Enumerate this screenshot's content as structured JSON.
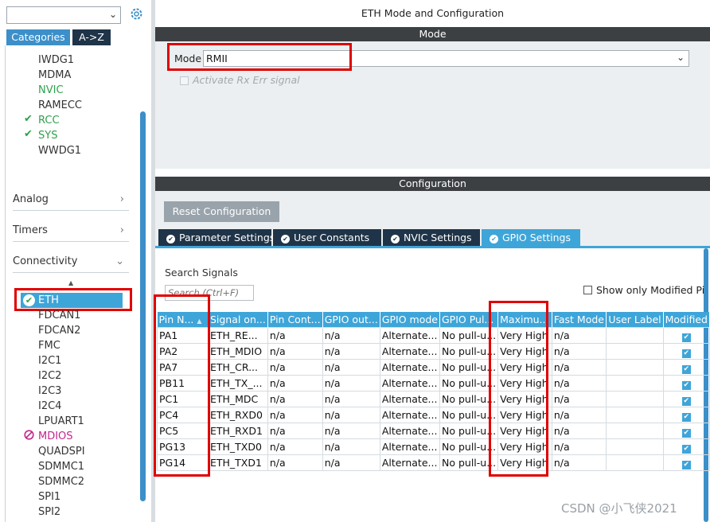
{
  "sidebar": {
    "tabs": [
      "Categories",
      "A->Z"
    ],
    "top_items": [
      {
        "label": "IWDG1",
        "state": "normal"
      },
      {
        "label": "MDMA",
        "state": "normal"
      },
      {
        "label": "NVIC",
        "state": "green"
      },
      {
        "label": "RAMECC",
        "state": "normal"
      },
      {
        "label": "RCC",
        "state": "checked"
      },
      {
        "label": "SYS",
        "state": "checked"
      },
      {
        "label": "WWDG1",
        "state": "normal"
      }
    ],
    "groups": [
      "Analog",
      "Timers",
      "Connectivity"
    ],
    "selected": "ETH",
    "connectivity_items": [
      {
        "label": "FDCAN1",
        "state": "normal"
      },
      {
        "label": "FDCAN2",
        "state": "normal"
      },
      {
        "label": "FMC",
        "state": "normal"
      },
      {
        "label": "I2C1",
        "state": "normal"
      },
      {
        "label": "I2C2",
        "state": "normal"
      },
      {
        "label": "I2C3",
        "state": "normal"
      },
      {
        "label": "I2C4",
        "state": "normal"
      },
      {
        "label": "LPUART1",
        "state": "normal"
      },
      {
        "label": "MDIOS",
        "state": "disabled"
      },
      {
        "label": "QUADSPI",
        "state": "normal"
      },
      {
        "label": "SDMMC1",
        "state": "normal"
      },
      {
        "label": "SDMMC2",
        "state": "normal"
      },
      {
        "label": "SPI1",
        "state": "normal"
      },
      {
        "label": "SPI2",
        "state": "normal"
      }
    ]
  },
  "main": {
    "title": "ETH Mode and Configuration",
    "mode_header": "Mode",
    "mode_label": "Mode",
    "mode_value": "RMII",
    "activate_label": "Activate Rx Err signal",
    "config_header": "Configuration",
    "reset_button": "Reset Configuration",
    "tabs": [
      "Parameter Settings",
      "User Constants",
      "NVIC Settings",
      "GPIO Settings"
    ],
    "active_tab": "GPIO Settings",
    "search_label": "Search Signals",
    "search_placeholder": "Search (Ctrl+F)",
    "show_modified": "Show only Modified Pin"
  },
  "table": {
    "headers": [
      "Pin N...",
      "Signal on...",
      "Pin Cont...",
      "GPIO out...",
      "GPIO mode",
      "GPIO Pul...",
      "Maximu...",
      "Fast Mode",
      "User Label",
      "Modified"
    ],
    "rows": [
      [
        "PA1",
        "ETH_RE...",
        "n/a",
        "n/a",
        "Alternate...",
        "No pull-u...",
        "Very High",
        "n/a",
        "",
        true
      ],
      [
        "PA2",
        "ETH_MDIO",
        "n/a",
        "n/a",
        "Alternate...",
        "No pull-u...",
        "Very High",
        "n/a",
        "",
        true
      ],
      [
        "PA7",
        "ETH_CR...",
        "n/a",
        "n/a",
        "Alternate...",
        "No pull-u...",
        "Very High",
        "n/a",
        "",
        true
      ],
      [
        "PB11",
        "ETH_TX_...",
        "n/a",
        "n/a",
        "Alternate...",
        "No pull-u...",
        "Very High",
        "n/a",
        "",
        true
      ],
      [
        "PC1",
        "ETH_MDC",
        "n/a",
        "n/a",
        "Alternate...",
        "No pull-u...",
        "Very High",
        "n/a",
        "",
        true
      ],
      [
        "PC4",
        "ETH_RXD0",
        "n/a",
        "n/a",
        "Alternate...",
        "No pull-u...",
        "Very High",
        "n/a",
        "",
        true
      ],
      [
        "PC5",
        "ETH_RXD1",
        "n/a",
        "n/a",
        "Alternate...",
        "No pull-u...",
        "Very High",
        "n/a",
        "",
        true
      ],
      [
        "PG13",
        "ETH_TXD0",
        "n/a",
        "n/a",
        "Alternate...",
        "No pull-u...",
        "Very High",
        "n/a",
        "",
        true
      ],
      [
        "PG14",
        "ETH_TXD1",
        "n/a",
        "n/a",
        "Alternate...",
        "No pull-u...",
        "Very High",
        "n/a",
        "",
        true
      ]
    ]
  },
  "watermark": "CSDN @小飞侠2021",
  "colors": {
    "accent": "#3ea5d9",
    "dark_tab": "#1f3448",
    "header": "#3c4043",
    "highlight": "#e00000",
    "ok_green": "#2ea14b",
    "disabled_pink": "#c4268c"
  },
  "icons": [
    "search-icon",
    "gear-icon",
    "chevron-down-icon",
    "check-icon",
    "disabled-icon",
    "sort-up-icon"
  ]
}
